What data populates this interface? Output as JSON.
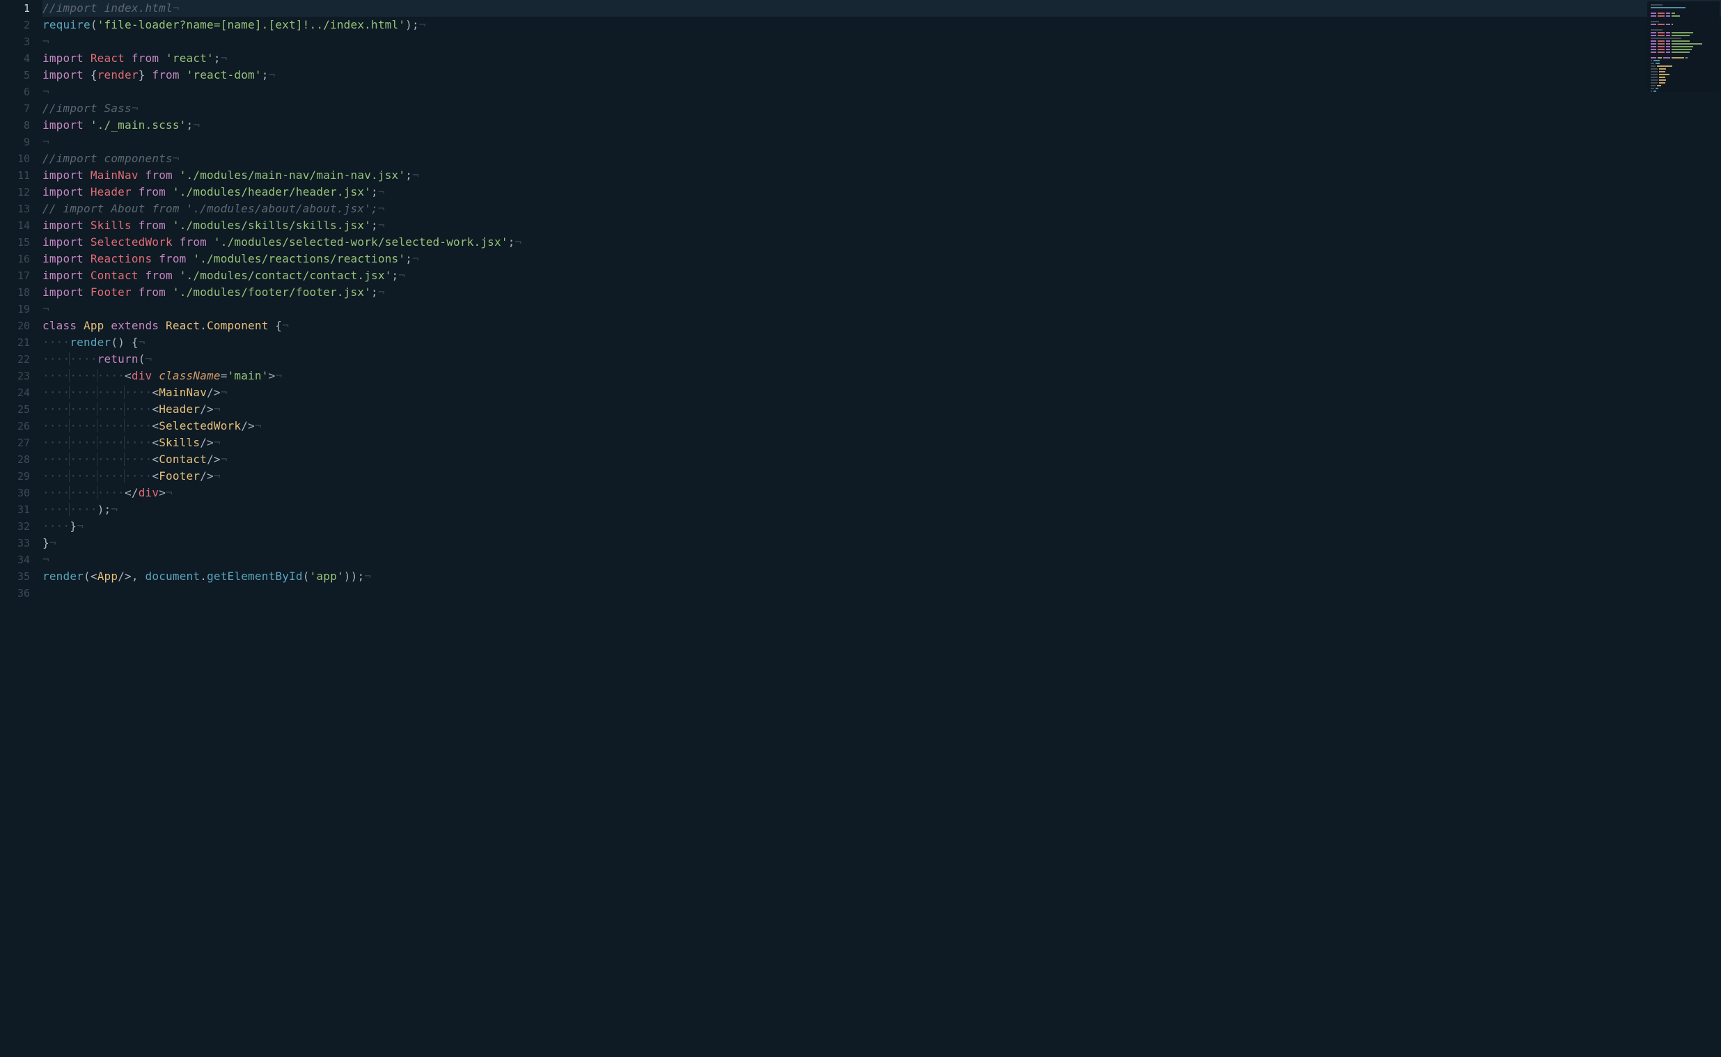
{
  "editor": {
    "active_line": 1,
    "total_lines": 36,
    "eol_marker": "¬",
    "dot_marker": "·",
    "lines": [
      {
        "n": 1,
        "raw": "//import index.html",
        "type": "comment"
      },
      {
        "n": 2,
        "raw": "require('file-loader?name=[name].[ext]!../index.html');",
        "type": "code"
      },
      {
        "n": 3,
        "raw": "",
        "type": "blank"
      },
      {
        "n": 4,
        "raw": "import React from 'react';",
        "type": "import"
      },
      {
        "n": 5,
        "raw": "import {render} from 'react-dom';",
        "type": "import"
      },
      {
        "n": 6,
        "raw": "",
        "type": "blank"
      },
      {
        "n": 7,
        "raw": "//import Sass",
        "type": "comment"
      },
      {
        "n": 8,
        "raw": "import './_main.scss';",
        "type": "import"
      },
      {
        "n": 9,
        "raw": "",
        "type": "blank"
      },
      {
        "n": 10,
        "raw": "//import components",
        "type": "comment"
      },
      {
        "n": 11,
        "raw": "import MainNav from './modules/main-nav/main-nav.jsx';",
        "type": "import"
      },
      {
        "n": 12,
        "raw": "import Header from './modules/header/header.jsx';",
        "type": "import"
      },
      {
        "n": 13,
        "raw": "// import About from './modules/about/about.jsx';",
        "type": "comment"
      },
      {
        "n": 14,
        "raw": "import Skills from './modules/skills/skills.jsx';",
        "type": "import"
      },
      {
        "n": 15,
        "raw": "import SelectedWork from './modules/selected-work/selected-work.jsx';",
        "type": "import"
      },
      {
        "n": 16,
        "raw": "import Reactions from './modules/reactions/reactions';",
        "type": "import"
      },
      {
        "n": 17,
        "raw": "import Contact from './modules/contact/contact.jsx';",
        "type": "import"
      },
      {
        "n": 18,
        "raw": "import Footer from './modules/footer/footer.jsx';",
        "type": "import"
      },
      {
        "n": 19,
        "raw": "",
        "type": "blank"
      },
      {
        "n": 20,
        "raw": "class App extends React.Component {",
        "type": "class"
      },
      {
        "n": 21,
        "raw": "    render() {",
        "type": "method",
        "indent": 4
      },
      {
        "n": 22,
        "raw": "        return(",
        "type": "return",
        "indent": 8
      },
      {
        "n": 23,
        "raw": "            <div className='main'>",
        "type": "jsx",
        "indent": 12
      },
      {
        "n": 24,
        "raw": "                <MainNav/>",
        "type": "jsx",
        "indent": 16
      },
      {
        "n": 25,
        "raw": "                <Header/>",
        "type": "jsx",
        "indent": 16
      },
      {
        "n": 26,
        "raw": "                <SelectedWork/>",
        "type": "jsx",
        "indent": 16
      },
      {
        "n": 27,
        "raw": "                <Skills/>",
        "type": "jsx",
        "indent": 16
      },
      {
        "n": 28,
        "raw": "                <Contact/>",
        "type": "jsx",
        "indent": 16
      },
      {
        "n": 29,
        "raw": "                <Footer/>",
        "type": "jsx",
        "indent": 16
      },
      {
        "n": 30,
        "raw": "            </div>",
        "type": "jsx",
        "indent": 12
      },
      {
        "n": 31,
        "raw": "        );",
        "type": "code",
        "indent": 8
      },
      {
        "n": 32,
        "raw": "    }",
        "type": "code",
        "indent": 4
      },
      {
        "n": 33,
        "raw": "}",
        "type": "code"
      },
      {
        "n": 34,
        "raw": "",
        "type": "blank"
      },
      {
        "n": 35,
        "raw": "render(<App/>, document.getElementById('app'));",
        "type": "code"
      },
      {
        "n": 36,
        "raw": "",
        "type": "final"
      }
    ]
  },
  "syntax": {
    "keywords": [
      "import",
      "from",
      "class",
      "extends",
      "return"
    ],
    "builtins": [
      "require",
      "render",
      "document",
      "getElementById"
    ],
    "components": [
      "React",
      "MainNav",
      "Header",
      "About",
      "Skills",
      "SelectedWork",
      "Reactions",
      "Contact",
      "Footer",
      "App",
      "Component"
    ]
  },
  "colors": {
    "background": "#0e1a24",
    "gutter": "#3e4a56",
    "gutter_active": "#c8ced6",
    "comment": "#5c6773",
    "keyword": "#c586c0",
    "identifier": "#e06c75",
    "string": "#98c379",
    "class": "#e5c07b",
    "function": "#5aa7bd",
    "attr": "#d19a66",
    "punct": "#abb2bf",
    "whitespace": "#3a4450"
  }
}
